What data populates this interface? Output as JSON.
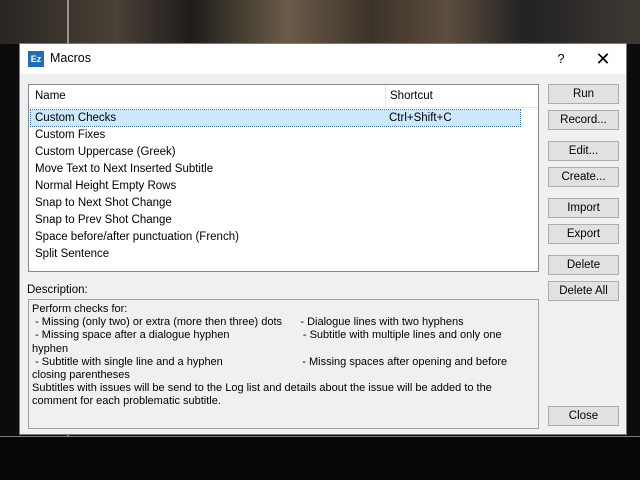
{
  "window": {
    "title": "Macros",
    "icon_text": "Ez",
    "help_label": "?",
    "close_label": "✕"
  },
  "list": {
    "columns": {
      "name": "Name",
      "shortcut": "Shortcut"
    },
    "rows": [
      {
        "name": "Custom Checks",
        "shortcut": "Ctrl+Shift+C",
        "selected": true
      },
      {
        "name": "Custom Fixes",
        "shortcut": ""
      },
      {
        "name": "Custom Uppercase (Greek)",
        "shortcut": ""
      },
      {
        "name": "Move Text to Next Inserted Subtitle",
        "shortcut": ""
      },
      {
        "name": "Normal Height Empty Rows",
        "shortcut": ""
      },
      {
        "name": "Snap to Next Shot Change",
        "shortcut": ""
      },
      {
        "name": "Snap to Prev Shot Change",
        "shortcut": ""
      },
      {
        "name": "Space before/after punctuation (French)",
        "shortcut": ""
      },
      {
        "name": "Split Sentence",
        "shortcut": ""
      }
    ]
  },
  "buttons": {
    "run": "Run",
    "record": "Record...",
    "edit": "Edit...",
    "create": "Create...",
    "import": "Import",
    "export": "Export",
    "delete": "Delete",
    "delete_all": "Delete All",
    "close": "Close"
  },
  "description": {
    "label": "Description:",
    "text": "Perform checks for:\n - Missing (only two) or extra (more then three) dots      - Dialogue lines with two hyphens\n - Missing space after a dialogue hyphen                        - Subtitle with multiple lines and only one hyphen\n - Subtitle with single line and a hyphen                          - Missing spaces after opening and before closing parentheses\nSubtitles with issues will be send to the Log list and details about the issue will be added to the comment for each problematic subtitle."
  }
}
